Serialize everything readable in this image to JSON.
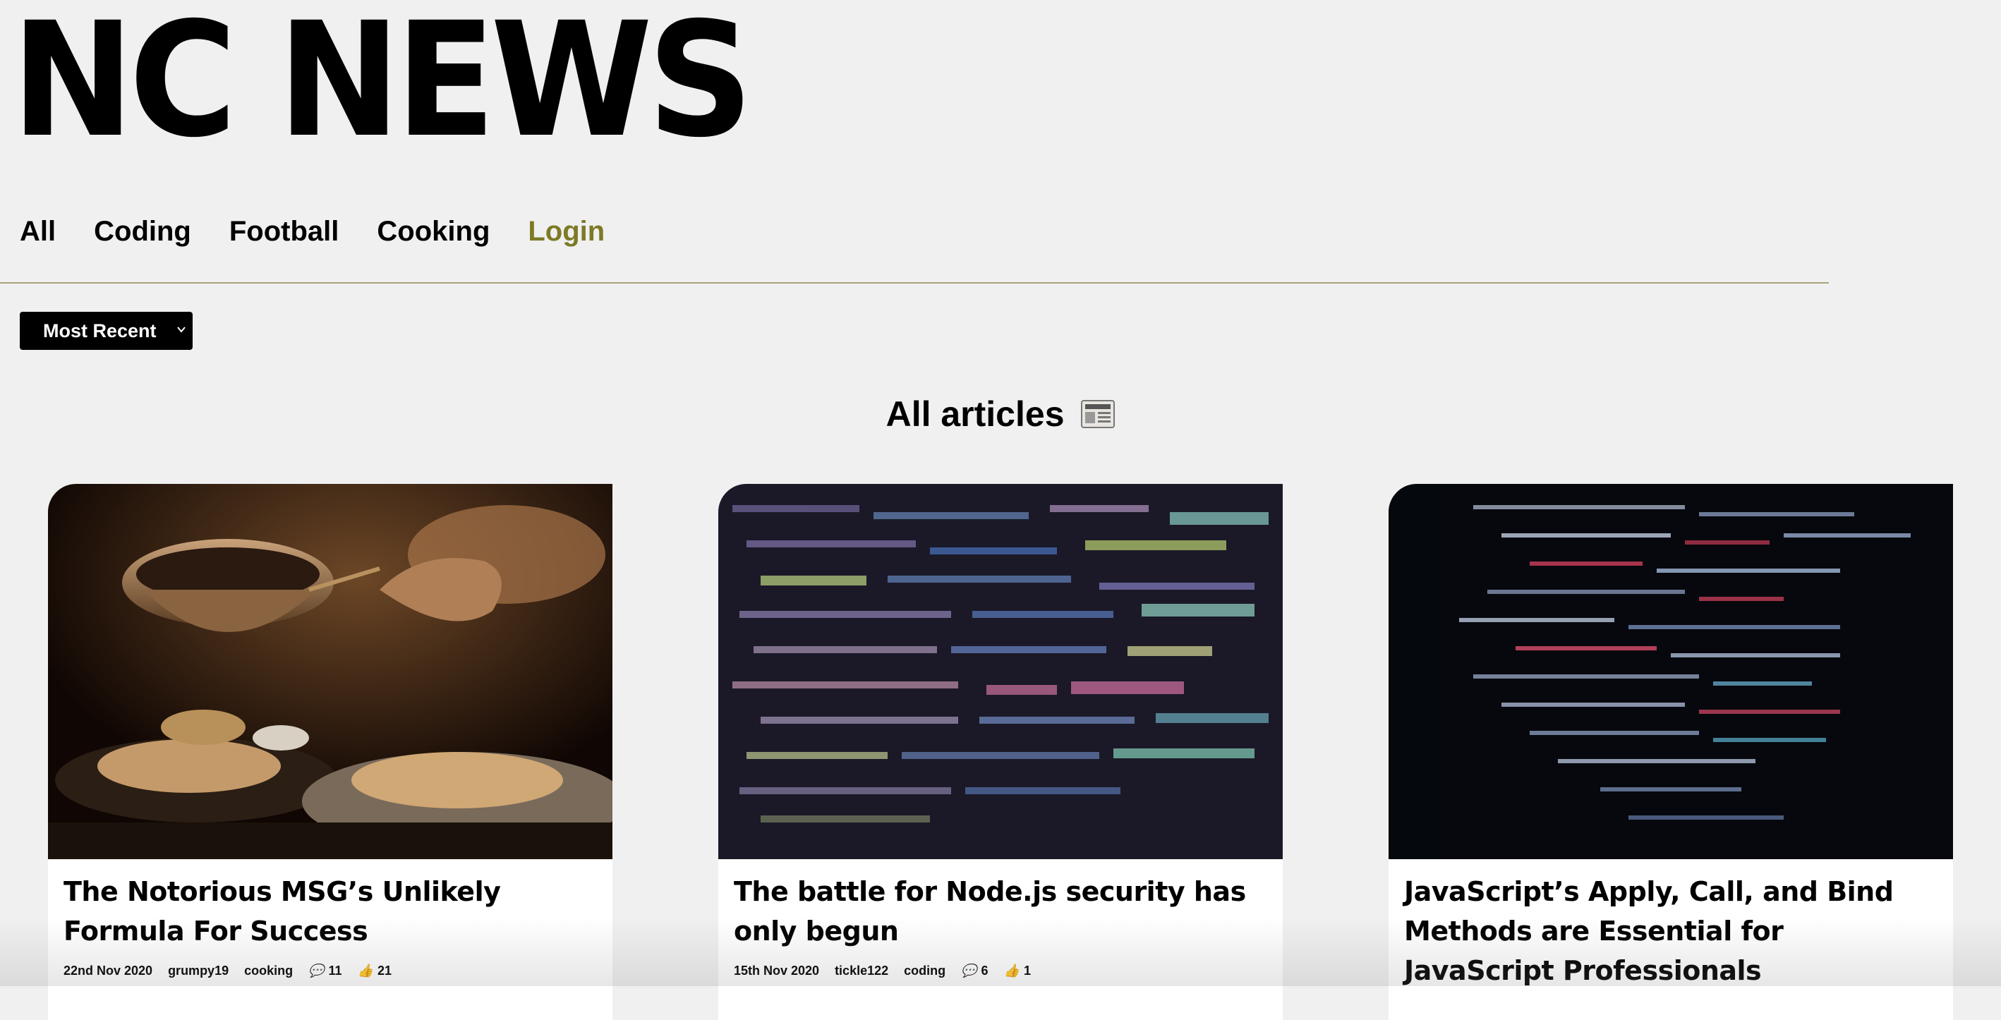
{
  "app": {
    "logo": "NC NEWS"
  },
  "nav": {
    "items": [
      {
        "label": "All"
      },
      {
        "label": "Coding"
      },
      {
        "label": "Football"
      },
      {
        "label": "Cooking"
      },
      {
        "label": "Login"
      }
    ]
  },
  "sort": {
    "selected": "Most Recent"
  },
  "section": {
    "title": "All articles"
  },
  "colors": {
    "accent": "#7d7a26",
    "rule": "#a7a47a",
    "background": "#f0f0f0"
  },
  "articles": [
    {
      "title": "The Notorious MSG’s Unlikely Formula For Success",
      "date": "22nd Nov 2020",
      "author": "grumpy19",
      "topic": "cooking",
      "comments": "11",
      "votes": "21",
      "image": "cooking-photo"
    },
    {
      "title": "The battle for Node.js security has only begun",
      "date": "15th Nov 2020",
      "author": "tickle122",
      "topic": "coding",
      "comments": "6",
      "votes": "1",
      "image": "code-screen-photo"
    },
    {
      "title": "JavaScript’s Apply, Call, and Bind Methods are Essential for JavaScript Professionals",
      "image": "code-screen-dark-photo"
    }
  ]
}
